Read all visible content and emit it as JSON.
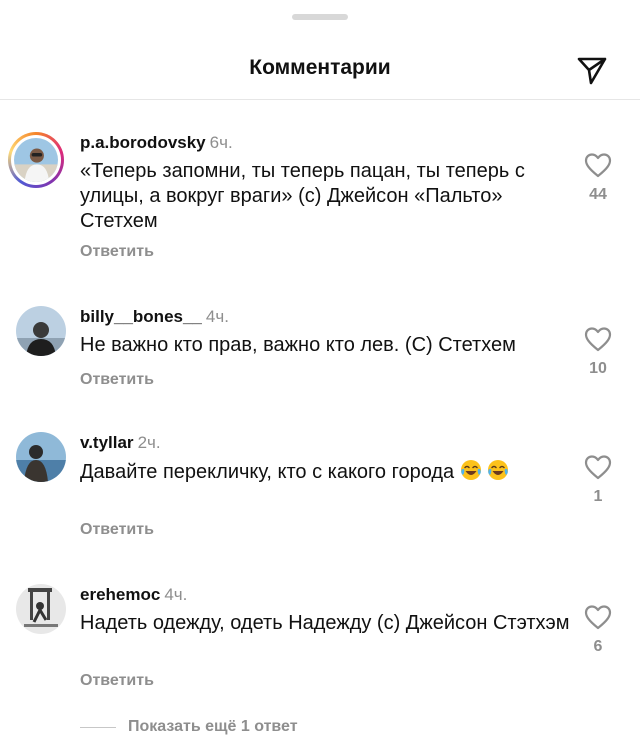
{
  "header": {
    "title": "Комментарии"
  },
  "comments": [
    {
      "username": "p.a.borodovsky",
      "time": "6ч.",
      "text": "«Теперь запомни, ты теперь пацан, ты теперь с улицы, а вокруг враги» (с) Джейсон «Пальто» Стетхем",
      "likes": "44",
      "reply_label": "Ответить"
    },
    {
      "username": "billy__bones__",
      "time": "4ч.",
      "text": "Не важно кто прав, важно кто лев. (С) Стетхем",
      "likes": "10",
      "reply_label": "Ответить"
    },
    {
      "username": "v.tyllar",
      "time": "2ч.",
      "text": "Давайте перекличку, кто с какого города",
      "likes": "1",
      "reply_label": "Ответить"
    },
    {
      "username": "erehemoc",
      "time": "4ч.",
      "text": "Надеть одежду, одеть Надежду (с) Джейсон Стэтхэм",
      "likes": "6",
      "reply_label": "Ответить"
    }
  ],
  "more_replies": {
    "label": "Показать ещё 1 ответ"
  },
  "icons": {
    "share": "paper-plane-icon",
    "like": "heart-outline-icon",
    "emoji": "face-with-tears-of-joy-emoji"
  },
  "colors": {
    "text": "#111111",
    "secondary": "#8e8e8e",
    "divider": "#e6e6e6"
  }
}
